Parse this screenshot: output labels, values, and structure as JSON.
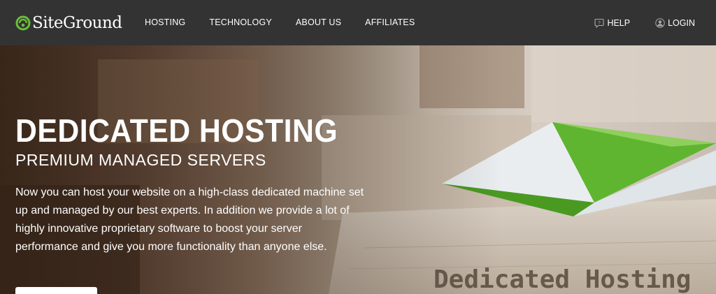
{
  "brand": {
    "name": "SiteGround",
    "accent_color": "#6bbd3b"
  },
  "nav": {
    "items": [
      {
        "label": "HOSTING"
      },
      {
        "label": "TECHNOLOGY"
      },
      {
        "label": "ABOUT US"
      },
      {
        "label": "AFFILIATES"
      }
    ],
    "help_label": "HELP",
    "login_label": "LOGIN"
  },
  "hero": {
    "title": "DEDICATED HOSTING",
    "subtitle": "PREMIUM MANAGED SERVERS",
    "description": "Now you can host your website on a high-class dedicated machine set up and managed by our best experts. In addition we provide a lot of highly innovative proprietary software to boost your server performance and give you more functionality than anyone else.",
    "image_caption": "Dedicated Hosting",
    "button_label": ""
  }
}
